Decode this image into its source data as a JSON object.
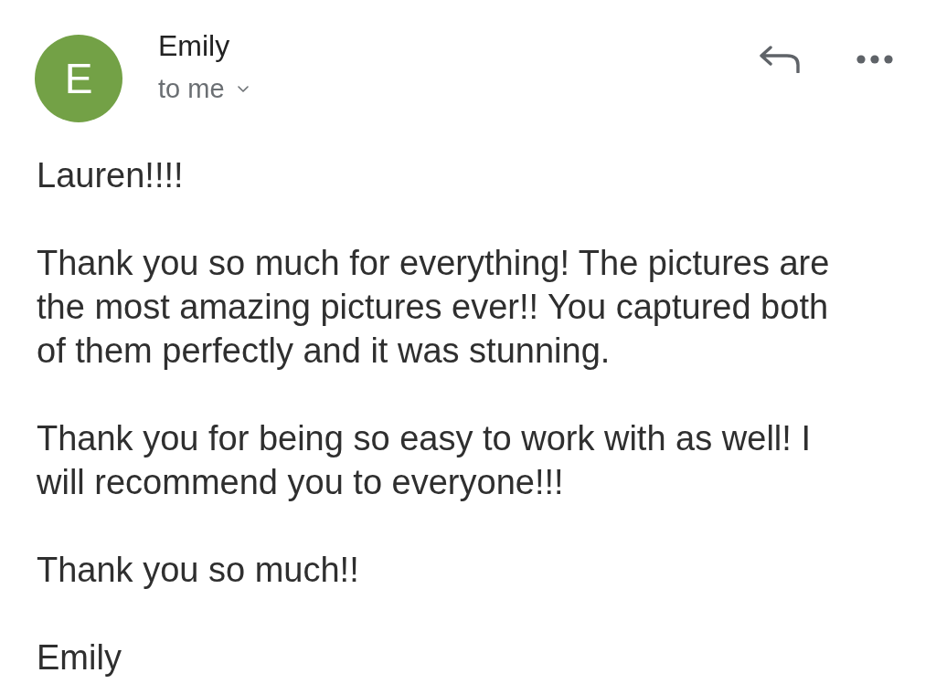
{
  "sender": {
    "initial": "E",
    "name": "Emily",
    "recipient": "to me"
  },
  "message": {
    "paragraphs": [
      "Lauren!!!!",
      "Thank you so much for everything! The pictures are the most amazing pictures ever!! You captured both of them perfectly and it was stunning.",
      "Thank you for being so easy to work with as well! I will recommend you to everyone!!!",
      "Thank you so much!!",
      "Emily"
    ]
  }
}
